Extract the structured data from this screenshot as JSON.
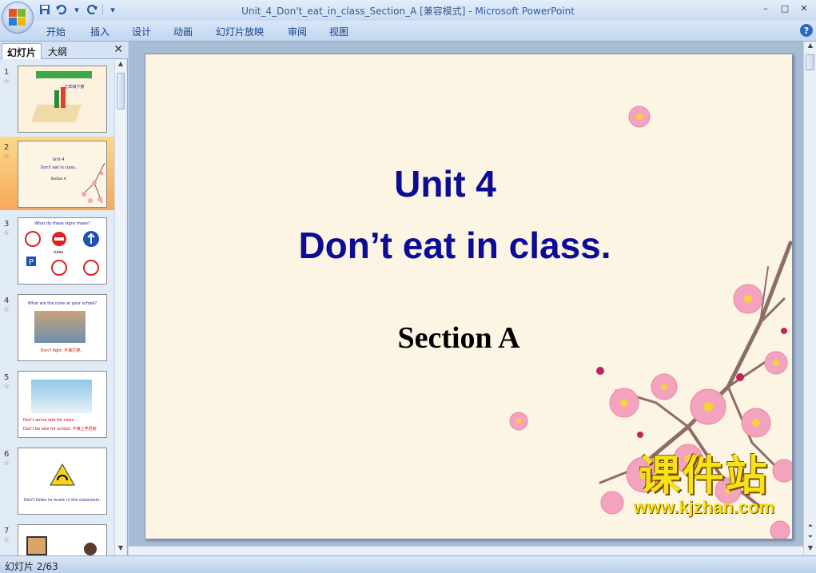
{
  "window": {
    "title": "Unit_4_Don't_eat_in_class_Section_A [兼容模式]",
    "title_separator": " - ",
    "app_name": "Microsoft PowerPoint",
    "minimize": "–",
    "maximize": "□",
    "close": "✕"
  },
  "ribbon": {
    "tabs": [
      "开始",
      "插入",
      "设计",
      "动画",
      "幻灯片放映",
      "审阅",
      "视图"
    ],
    "help": "?"
  },
  "left_pane": {
    "tabs": [
      "幻灯片",
      "大纲"
    ],
    "close": "✕",
    "slides": [
      {
        "num": "1",
        "lines": [
          "七年级下册"
        ]
      },
      {
        "num": "2",
        "lines": [
          "Unit 4",
          "Don't eat in class.",
          "Section A"
        ]
      },
      {
        "num": "3",
        "lines": [
          "What do these signs mean?",
          "rules"
        ]
      },
      {
        "num": "4",
        "lines": [
          "What are the rules at your school?",
          "Don't fight.  不准打架。"
        ]
      },
      {
        "num": "5",
        "lines": [
          "Don't arrive late for class.",
          "Don't be late for school.  不准上学迟到"
        ]
      },
      {
        "num": "6",
        "lines": [
          "Don't listen to music in the classroom."
        ]
      },
      {
        "num": "7",
        "lines": []
      }
    ]
  },
  "slide": {
    "title_line1": "Unit 4",
    "title_line2": "Don’t eat in class.",
    "subtitle": "Section A",
    "watermark_cn": "课件站",
    "watermark_url": "www.kjzhan.com"
  },
  "status": {
    "slide_info": "幻灯片 2/63"
  },
  "colors": {
    "title_blue": "#0c0c96",
    "slide_bg": "#fcf5e4",
    "blossom": "#f3a3be",
    "branch": "#8c6e68",
    "watermark": "#f5e317"
  }
}
